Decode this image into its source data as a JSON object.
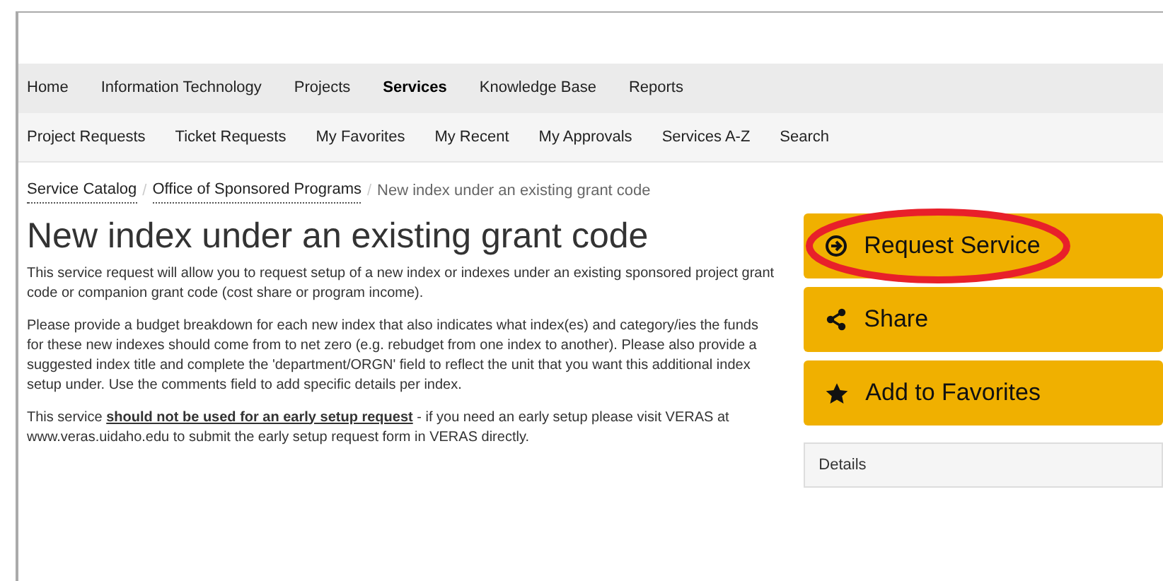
{
  "main_nav": [
    {
      "label": "Home",
      "selected": false
    },
    {
      "label": "Information Technology",
      "selected": false
    },
    {
      "label": "Projects",
      "selected": false
    },
    {
      "label": "Services",
      "selected": true
    },
    {
      "label": "Knowledge Base",
      "selected": false
    },
    {
      "label": "Reports",
      "selected": false
    }
  ],
  "sub_nav": [
    "Project Requests",
    "Ticket Requests",
    "My Favorites",
    "My Recent",
    "My Approvals",
    "Services A-Z",
    "Search"
  ],
  "breadcrumb": {
    "links": [
      "Service Catalog",
      "Office of Sponsored Programs"
    ],
    "current": "New index under an existing grant code",
    "separator": "/"
  },
  "title": "New index under an existing grant code",
  "paragraphs": [
    "This service request will allow you to request setup of a new index or indexes under an existing sponsored project grant code or companion grant code (cost share or program income).",
    "Please provide a budget breakdown for each new index that also indicates what index(es) and category/ies the funds for these new indexes should come from to net zero (e.g. rebudget from one index to another). Please also provide a suggested index title and complete the 'department/ORGN' field to reflect the unit that you want this additional index setup under. Use the comments field to add specific details per index.",
    "This service **should not be used for an early setup request** - if you need an early setup please visit VERAS at www.veras.uidaho.edu to submit the early setup request form in VERAS directly."
  ],
  "actions": [
    {
      "kind": "request",
      "label": "Request Service",
      "highlighted": true
    },
    {
      "kind": "share",
      "label": "Share",
      "highlighted": false
    },
    {
      "kind": "favorite",
      "label": "Add to Favorites",
      "highlighted": false
    }
  ],
  "details": {
    "title": "Details"
  }
}
